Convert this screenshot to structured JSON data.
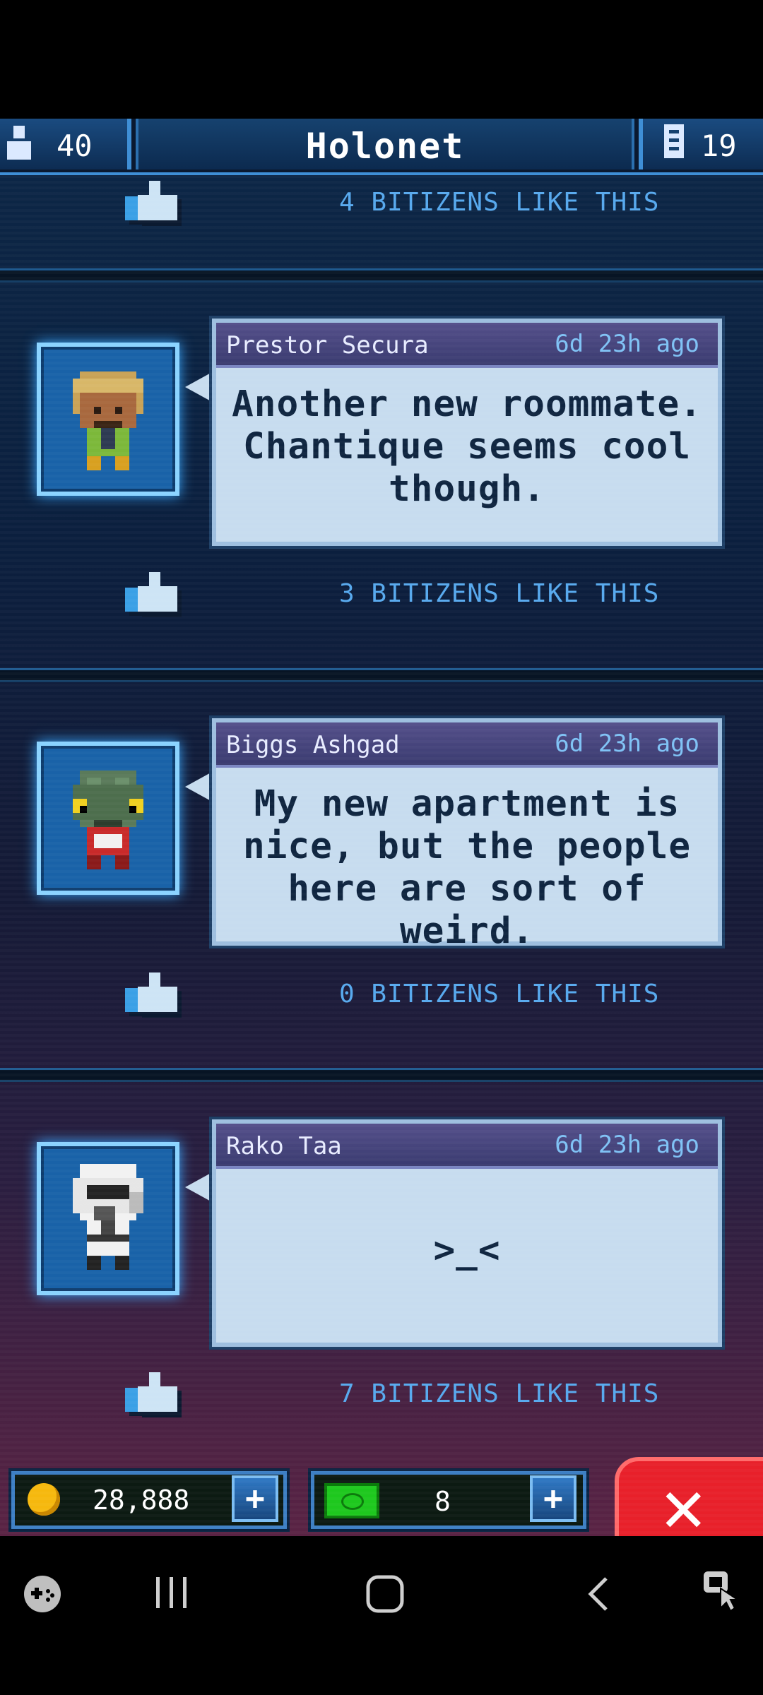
{
  "header": {
    "population": "40",
    "title": "Holonet",
    "floors": "19"
  },
  "posts": [
    {
      "likes": "4 BITIZENS LIKE THIS"
    },
    {
      "name": "Prestor Secura",
      "time": "6d 23h ago",
      "message": "Another new roommate. Chantique seems cool though.",
      "likes": "3 BITIZENS LIKE THIS"
    },
    {
      "name": "Biggs Ashgad",
      "time": "6d 23h ago",
      "message": "My new apartment is nice, but the people here are sort of weird.",
      "likes": "0 BITIZENS LIKE THIS"
    },
    {
      "name": "Rako Taa",
      "time": "6d 23h ago",
      "message": ">_<",
      "likes": "7 BITIZENS LIKE THIS"
    }
  ],
  "bottom_bar": {
    "coins": "28,888",
    "bux": "8"
  },
  "colors": {
    "accent": "#3f8fd6",
    "close_button": "#e8202a",
    "like_text": "#57a9ee"
  }
}
